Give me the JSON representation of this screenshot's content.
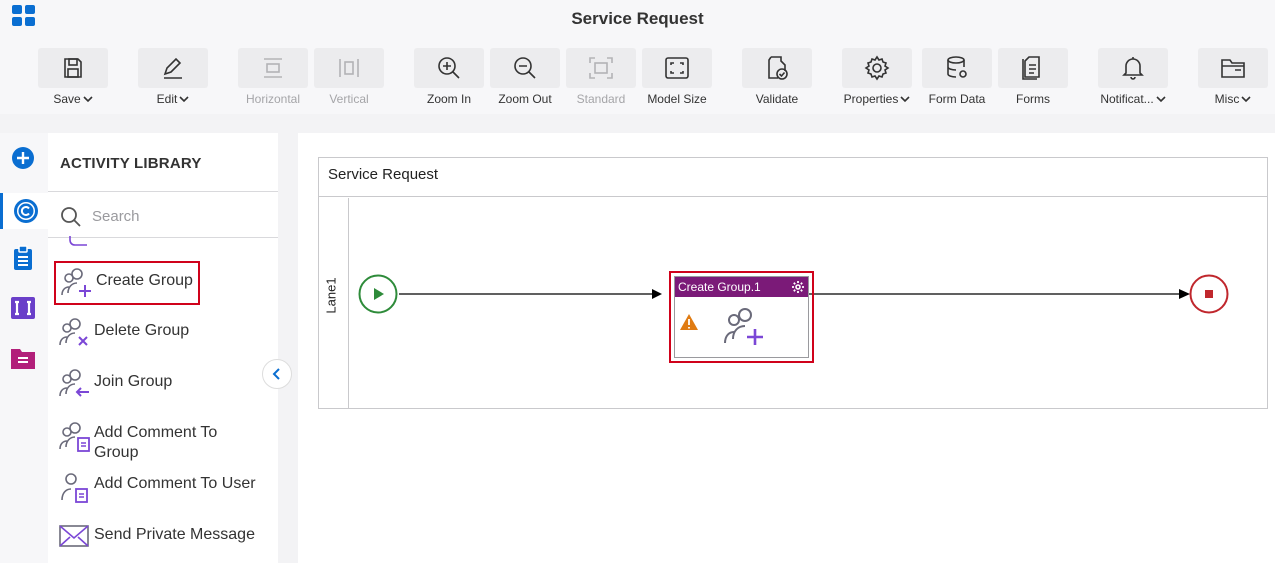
{
  "app": {
    "title": "Service Request"
  },
  "toolbar": {
    "save": "Save",
    "edit": "Edit",
    "horizontal": "Horizontal",
    "vertical": "Vertical",
    "zoom_in": "Zoom In",
    "zoom_out": "Zoom Out",
    "standard": "Standard",
    "model_size": "Model Size",
    "validate": "Validate",
    "properties": "Properties",
    "form_data": "Form Data",
    "forms": "Forms",
    "notifications": "Notificat...",
    "misc": "Misc"
  },
  "library": {
    "title": "ACTIVITY LIBRARY",
    "search_placeholder": "Search",
    "items": [
      {
        "label": "Create Group",
        "icon": "create-group-icon"
      },
      {
        "label": "Delete Group",
        "icon": "delete-group-icon"
      },
      {
        "label": "Join Group",
        "icon": "join-group-icon"
      },
      {
        "label": "Add Comment To Group",
        "icon": "add-comment-group-icon"
      },
      {
        "label": "Add Comment To User",
        "icon": "add-comment-user-icon"
      },
      {
        "label": "Send Private Message",
        "icon": "envelope-icon"
      }
    ]
  },
  "canvas": {
    "pool_title": "Service Request",
    "lane_label": "Lane1",
    "activity_title": "Create Group.1"
  },
  "colors": {
    "accent": "#0a6ed1",
    "activity_header": "#7b1a78",
    "selection": "#d0021b",
    "start": "#2e8b3a",
    "end": "#c0272d",
    "purple_icon": "#7b47d6"
  }
}
